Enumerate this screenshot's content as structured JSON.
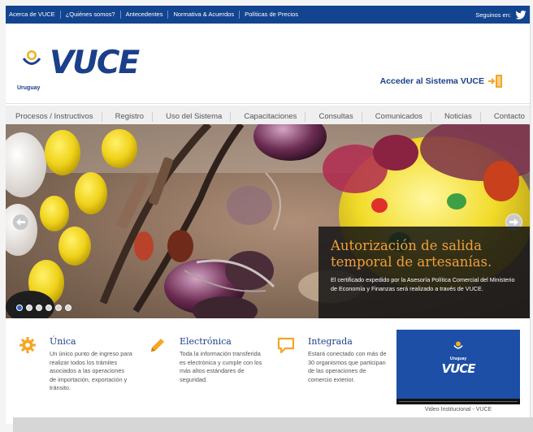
{
  "topbar": {
    "links": [
      "Acerca de VUCE",
      "¿Quiénes somos?",
      "Antecedentes",
      "Normativa & Acuerdos",
      "Políticas de Precios"
    ],
    "follow_label": "Seguinos en:",
    "social_icon": "twitter-icon"
  },
  "header": {
    "logo_country": "Uruguay",
    "logo_word": "VUCE",
    "access_label": "Acceder al Sistema VUCE"
  },
  "nav": {
    "items": [
      "Procesos / Instructivos",
      "Registro",
      "Uso del Sistema",
      "Capacitaciones",
      "Consultas",
      "Comunicados",
      "Noticias",
      "Contacto"
    ]
  },
  "hero": {
    "title": "Autorización de salida temporal de artesanías.",
    "text": "El certificado expedido por la Asesoría Política Comercial del Ministerio de Economía y Finanzas será realizado a través de VUCE.",
    "slides_count": 6,
    "active_slide": 1
  },
  "features": [
    {
      "title": "Única",
      "text": "Un único punto de ingreso para realizar todos los trámites asociados a las operaciones de importación, exportación y tránsito.",
      "icon": "gear-icon"
    },
    {
      "title": "Electrónica",
      "text": "Toda la información transferida es electrónica y cumple con los más altos estándares de seguridad.",
      "icon": "pencil-icon"
    },
    {
      "title": "Integrada",
      "text": "Estará conectado con más de 30 organismos que participan de las operaciones de comercio exterior.",
      "icon": "chat-bubble-icon"
    }
  ],
  "video": {
    "logo_country": "Uruguay",
    "logo_word": "VUCE",
    "caption": "Video Institucional - VUCE"
  },
  "colors": {
    "brand_blue": "#1b3f8b",
    "topbar_blue": "#13448f",
    "accent_orange": "#f0a03c",
    "feature_icon": "#f5a623"
  }
}
